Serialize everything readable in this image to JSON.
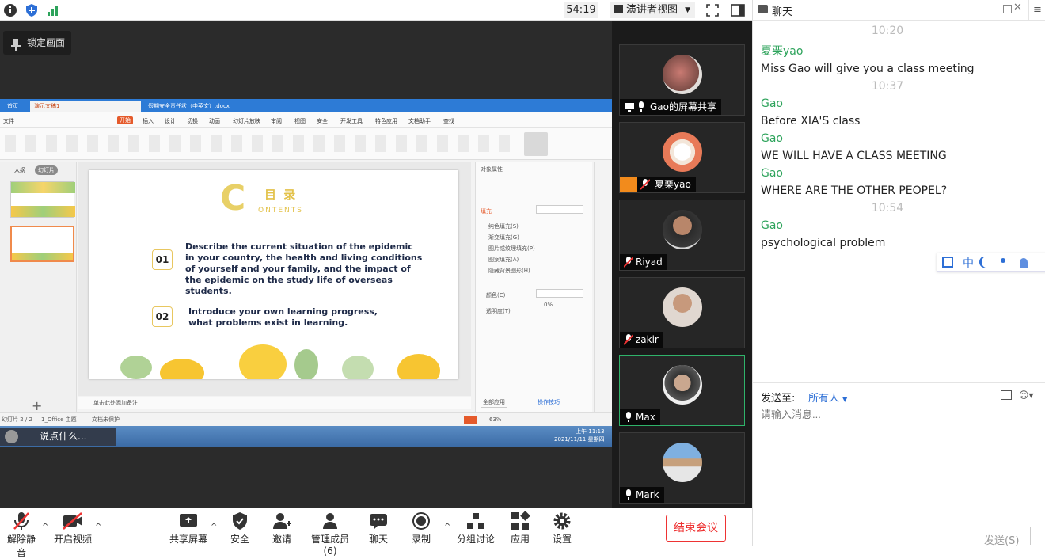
{
  "topbar": {
    "timer": "54:19",
    "presenter_view_label": "演讲者视图",
    "icons": [
      "info-icon",
      "shield-icon",
      "signal-icon",
      "fullscreen-icon",
      "sidebar-icon"
    ]
  },
  "stage": {
    "lock_label": "锁定画面",
    "shared_app": {
      "tabs": [
        "首页",
        "演示文稿1",
        "假期安全责任状（中英文）.docx"
      ],
      "menu": [
        "文件",
        "开始",
        "插入",
        "设计",
        "切换",
        "动画",
        "幻灯片放映",
        "审阅",
        "视图",
        "安全",
        "开发工具",
        "特色应用",
        "文档助手",
        "查找"
      ],
      "slide": {
        "logo_letter": "C",
        "heading": "目 录",
        "subheading": "ONTENTS",
        "items": [
          {
            "num": "01",
            "text": "Describe the current situation of the epidemic in your country, the health and living conditions of yourself and your family, and the impact of the epidemic on the study life of overseas students."
          },
          {
            "num": "02",
            "text": "Introduce your own learning progress, what problems exist in learning."
          }
        ]
      },
      "notes_placeholder": "单击此处添加备注",
      "status_left": "幻灯片 2 / 2",
      "status_theme": "1_Office 主题",
      "status_protect": "文档未保护",
      "zoom": "63%",
      "thumb_tabs": [
        "大纲",
        "幻灯片"
      ],
      "props_title": "对象属性",
      "props_fill": "填充",
      "props_options": [
        "纯色填充(S)",
        "渐变填充(G)",
        "图片或纹理填充(P)",
        "图案填充(A)",
        "隐藏背景图形(H)"
      ],
      "props_color": "颜色(C)",
      "props_transparency": "透明度(T)",
      "props_transparency_value": "0%",
      "props_apply_all": "全部应用",
      "props_tips": "操作技巧",
      "taskbar_time": "上午 11:13",
      "taskbar_date": "2021/11/11 星期四",
      "taskbar_say": "说点什么..."
    }
  },
  "participants": [
    {
      "name": "Gao的屏幕共享",
      "status": "screen-share"
    },
    {
      "name": "夏栗yao",
      "status": "muted"
    },
    {
      "name": "Riyad",
      "status": "muted"
    },
    {
      "name": "zakir",
      "status": "muted"
    },
    {
      "name": "Max",
      "status": "unmuted"
    },
    {
      "name": "Mark",
      "status": "unmuted"
    }
  ],
  "chat": {
    "title": "聊天",
    "messages": [
      {
        "time": "10:20"
      },
      {
        "sender": "夏栗yao",
        "text": "Miss Gao will give you a class meeting"
      },
      {
        "time": "10:37"
      },
      {
        "sender": "Gao",
        "text": "Before XIA'S class"
      },
      {
        "sender": "Gao",
        "text": "WE WILL HAVE A CLASS MEETING"
      },
      {
        "sender": "Gao",
        "text": "WHERE ARE THE OTHER PEOPEL?"
      },
      {
        "time": "10:54"
      },
      {
        "sender": "Gao",
        "text": "psychological problem"
      }
    ],
    "ime_label": "中",
    "send_to_label": "发送至:",
    "recipient": "所有人",
    "input_placeholder": "请输入消息...",
    "send_label": "发送(S)"
  },
  "toolbar": {
    "unmute": "解除静音",
    "start_video": "开启视频",
    "share_screen": "共享屏幕",
    "security": "安全",
    "invite": "邀请",
    "manage_members": "管理成员(6)",
    "chat": "聊天",
    "record": "录制",
    "breakout": "分组讨论",
    "apps": "应用",
    "settings": "设置",
    "end_meeting": "结束会议"
  },
  "colors": {
    "accent_green": "#2da35b",
    "accent_blue": "#2d6fd6",
    "end_red": "#e33333"
  }
}
